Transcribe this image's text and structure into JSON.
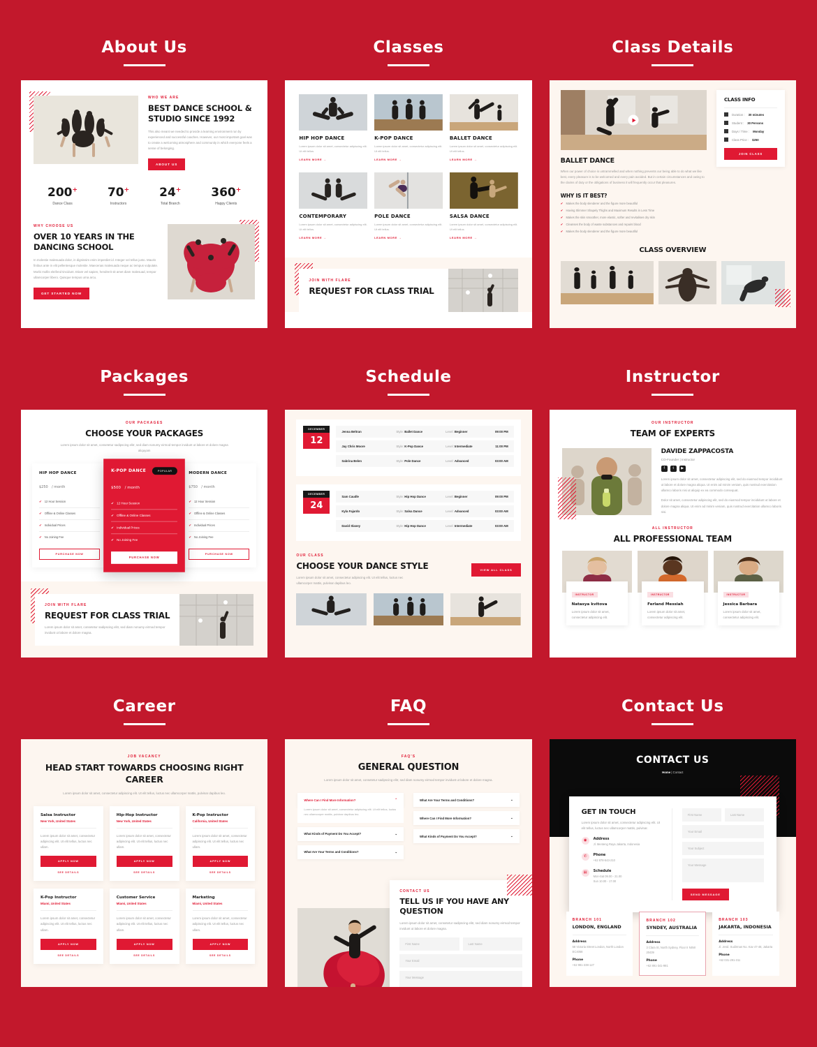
{
  "sections": [
    {
      "title": "About Us"
    },
    {
      "title": "Classes"
    },
    {
      "title": "Class Details"
    },
    {
      "title": "Packages"
    },
    {
      "title": "Schedule"
    },
    {
      "title": "Instructor"
    },
    {
      "title": "Career"
    },
    {
      "title": "FAQ"
    },
    {
      "title": "Contact Us"
    }
  ],
  "about": {
    "eyebrow": "WHO WE ARE",
    "heading": "BEST DANCE SCHOOL & STUDIO SINCE 1992",
    "body": "This also meant we needed to provide a learning environment run by experienced and successful coaches. However, our most important goal was to create a welcoming atmosphere and community in which everyone feels a sense of belonging.",
    "cta": "ABOUT US",
    "stats": [
      {
        "num": "200",
        "sup": "+",
        "label": "Dance Class"
      },
      {
        "num": "70",
        "sup": "+",
        "label": "Instructors"
      },
      {
        "num": "24",
        "sup": "+",
        "label": "Total Branch"
      },
      {
        "num": "360",
        "sup": "+",
        "label": "Happy Clients"
      }
    ],
    "why_eyebrow": "WHY CHOOSE US",
    "why_heading": "OVER 10 YEARS IN THE DANCING SCHOOL",
    "why_body": "In molestie malesuada dolor, in dignissim enim imperdiet id. Integer vel tellus justo. Mauris finibus ante in elit pellentesque molestie. Maecenas malesuada neque ac tempus vulputate. Morbi mollis eleifend tincidunt. Etiam vel sapien, hendrerit sit amet diam malesuad, tempor ullamcorper libero. Quisque tempus urna arcu.",
    "why_cta": "GET STARTED NOW"
  },
  "classes": {
    "items": [
      {
        "title": "HIP HOP DANCE",
        "desc": "Lorem ipsum dolor sit amet, consectetur adipiscing elit. Ut elit tellus.",
        "link": "LEARN MORE →"
      },
      {
        "title": "K-POP DANCE",
        "desc": "Lorem ipsum dolor sit amet, consectetur adipiscing elit. Ut elit tellus.",
        "link": "LEARN MORE →"
      },
      {
        "title": "BALLET DANCE",
        "desc": "Lorem ipsum dolor sit amet, consectetur adipiscing elit. Ut elit tellus.",
        "link": "LEARN MORE →"
      },
      {
        "title": "CONTEMPORARY",
        "desc": "Lorem ipsum dolor sit amet, consectetur adipiscing elit. Ut elit tellus.",
        "link": "LEARN MORE →"
      },
      {
        "title": "POLE DANCE",
        "desc": "Lorem ipsum dolor sit amet, consectetur adipiscing elit. Ut elit tellus.",
        "link": "LEARN MORE →"
      },
      {
        "title": "SALSA DANCE",
        "desc": "Lorem ipsum dolor sit amet, consectetur adipiscing elit. Ut elit tellus.",
        "link": "LEARN MORE →"
      }
    ],
    "trial_eyebrow": "JOIN WITH FLARE",
    "trial_heading": "REQUEST FOR CLASS TRIAL"
  },
  "class_details": {
    "info_title": "CLASS INFO",
    "rows": [
      {
        "label": "Duration :",
        "value": "30 minutes"
      },
      {
        "label": "Student :",
        "value": "30 Persons"
      },
      {
        "label": "Days / Time :",
        "value": "Monday"
      },
      {
        "label": "Class Price :",
        "value": "$250"
      }
    ],
    "join_btn": "JOIN CLASS",
    "title": "BALLET DANCE",
    "body": "When our power of choice is untrammelled and when nothing prevents our being able to do what we like best, every pleasure is to be welcomed and every pain avoided. But in certain circumstances and owing to the claims of duty or the obligations of business it will frequently occur that pleasures.",
    "why_title": "WHY IS IT BEST?",
    "why_items": [
      "Makes the body slenderer and the figure more beautiful",
      "Having Slimmer Shapely Thighs and Maximum Results in Less Time",
      "Makes the skin smoother, more elastic, softer and revitalises dry skin",
      "Cleanses the body of waste substances and repairs blood",
      "Makes the body slenderer and the figure more beautiful"
    ],
    "overview_title": "CLASS OVERVIEW"
  },
  "packages": {
    "eyebrow": "OUR PACKAGES",
    "heading": "CHOOSE YOUR PACKAGES",
    "sub": "Lorem ipsum dolor sit amet, consetetur sadipscing elitr, sed diam nonumy eirmod tempor invidunt ut labore et dolore magna aliquyam",
    "popular_badge": "POPULAR",
    "cards": [
      {
        "name": "HIP HOP DANCE",
        "price": "$250",
        "period": "/ month",
        "features": [
          "12 Hour Session",
          "Offline & Online Classes",
          "Individual Prices",
          "No Joining Fee"
        ],
        "btn": "PURCHASE NOW"
      },
      {
        "name": "K-POP DANCE",
        "price": "$500",
        "period": "/ month",
        "features": [
          "12 Hour Session",
          "Offline & Online Classes",
          "Individual Prices",
          "No Joining Fee"
        ],
        "btn": "PURCHASE NOW"
      },
      {
        "name": "MODERN DANCE",
        "price": "$750",
        "period": "/ month",
        "features": [
          "12 Hour Session",
          "Offline & Online Classes",
          "Individual Prices",
          "No Joining Fee"
        ],
        "btn": "PURCHASE NOW"
      }
    ],
    "trial_eyebrow": "JOIN WITH FLARE",
    "trial_heading": "REQUEST FOR CLASS TRIAL",
    "trial_body": "Lorem ipsum dolor sit amet, consetetur sadipscing elitr, sed diam nonumy eirmod tempor invidunt ut labore et dolore magna."
  },
  "schedule": {
    "blocks": [
      {
        "month": "DECEMBER",
        "day": "12",
        "rows": [
          {
            "name": "Jenna Beltran",
            "style_label": "Style:",
            "style": "Ballet Dance",
            "level_label": "Level:",
            "level": "Beginner",
            "time": "09:00 PM"
          },
          {
            "name": "Jay Chris Moore",
            "style_label": "Style:",
            "style": "K-Pop Dance",
            "level_label": "Level:",
            "level": "Intermediate",
            "time": "11:00 PM"
          },
          {
            "name": "Sabrina Belen",
            "style_label": "Style:",
            "style": "Pole Dance",
            "level_label": "Level:",
            "level": "Advanced",
            "time": "03:00 AM"
          }
        ]
      },
      {
        "month": "DECEMBER",
        "day": "24",
        "rows": [
          {
            "name": "Sam Caudle",
            "style_label": "Style:",
            "style": "Hip Hop Dance",
            "level_label": "Level:",
            "level": "Beginner",
            "time": "09:00 PM"
          },
          {
            "name": "Kyla Fajardo",
            "style_label": "Style:",
            "style": "Salsa Dance",
            "level_label": "Level:",
            "level": "Advanced",
            "time": "03:00 AM"
          },
          {
            "name": "David Slaney",
            "style_label": "Style:",
            "style": "Hip Hop Dance",
            "level_label": "Level:",
            "level": "Intermediate",
            "time": "03:00 AM"
          }
        ]
      }
    ],
    "style_eyebrow": "OUR CLASS",
    "style_heading": "CHOOSE YOUR DANCE STYLE",
    "style_body": "Lorem ipsum dolor sit amet, consectetur adipiscing elit. Ut elit tellus, luctus nec ullamcorper mattis, pulvinar dapibus leo.",
    "view_all": "VIEW ALL CLASS"
  },
  "instructor": {
    "eyebrow": "OUR INSTRUCTOR",
    "heading": "TEAM OF EXPERTS",
    "name": "DAVIDE ZAPPACOSTA",
    "role": "CO-Founder  |  Instructor",
    "bio1": "Lorem ipsum dolor sit amet, consectetur adipiscing elit, sed do eiusmod tempor incididunt ut labore et dolore magna aliqua. Ut enim ad minim veniam, quis nostrud exercitation ullamco laboris nisi ut aliquip ex ea commodo consequat.",
    "bio2": "Dolor sit amet, consectetur adipiscing elit, sed do eiusmod tempor incididunt ut labore et dolore magna aliqua. Ut enim ad minim veniam, quis nostrud exercitation ullamco laboris nisi.",
    "team_eyebrow": "ALL INSTRUCTOR",
    "team_heading": "ALL PROFESSIONAL TEAM",
    "team": [
      {
        "tag": "INSTRUCTOR",
        "name": "Natasya kvitova",
        "desc": "Lorem ipsum dolor sit amet, consectetur adipiscing elit."
      },
      {
        "tag": "INSTRUCTOR",
        "name": "Ferland Messiah",
        "desc": "Lorem ipsum dolor sit amet, consectetur adipiscing elit."
      },
      {
        "tag": "INSTRUCTOR",
        "name": "Jessica Barbara",
        "desc": "Lorem ipsum dolor sit amet, consectetur adipiscing elit."
      }
    ]
  },
  "career": {
    "eyebrow": "JOB VACANCY",
    "heading": "HEAD START TOWARDS CHOOSING RIGHT CAREER",
    "sub": "Lorem ipsum dolor sit amet, consectetur adipiscing elit. Ut elit tellus, luctus nec ullamcorper mattis, pulvinar dapibus leo.",
    "jobs": [
      {
        "title": "Salsa Instructor",
        "loc": "New York, United States",
        "desc": "Lorem ipsum dolor sit amet, consectetur adipiscing elit. Ut elit tellus, luctus nec ullam.",
        "apply": "APPLY NOW",
        "details": "SEE DETAILS"
      },
      {
        "title": "Hip-Hop Instructor",
        "loc": "New York, United States",
        "desc": "Lorem ipsum dolor sit amet, consectetur adipiscing elit. Ut elit tellus, luctus nec ullam.",
        "apply": "APPLY NOW",
        "details": "SEE DETAILS"
      },
      {
        "title": "K-Pop Instructor",
        "loc": "California, United States",
        "desc": "Lorem ipsum dolor sit amet, consectetur adipiscing elit. Ut elit tellus, luctus nec ullam.",
        "apply": "APPLY NOW",
        "details": "SEE DETAILS"
      },
      {
        "title": "K-Pop Instructor",
        "loc": "Miami, United States",
        "desc": "Lorem ipsum dolor sit amet, consectetur adipiscing elit. Ut elit tellus, luctus nec ullam.",
        "apply": "APPLY NOW",
        "details": "SEE DETAILS"
      },
      {
        "title": "Customer Service",
        "loc": "Miami, United States",
        "desc": "Lorem ipsum dolor sit amet, consectetur adipiscing elit. Ut elit tellus, luctus nec ullam.",
        "apply": "APPLY NOW",
        "details": "SEE DETAILS"
      },
      {
        "title": "Marketing",
        "loc": "Miami, United States",
        "desc": "Lorem ipsum dolor sit amet, consectetur adipiscing elit. Ut elit tellus, luctus nec ullam.",
        "apply": "APPLY NOW",
        "details": "SEE DETAILS"
      }
    ]
  },
  "faq": {
    "eyebrow": "FAQ'S",
    "heading": "GENERAL QUESTION",
    "sub": "Lorem ipsum dolor sit amet, consetetur sadipscing elitr, sed diam nonumy eirmod tempor invidunt ut labore et dolore magna.",
    "left": [
      {
        "q": "Where Can I Find More Information?",
        "open": true,
        "a": "Lorem ipsum dolor sit amet, consectetur adipiscing elit. Ut elit tellus, luctus nec ullamcorper mattis, pulvinar dapibus leo."
      },
      {
        "q": "What Kinds of Payment Do You Accept?",
        "open": false
      },
      {
        "q": "What Are Your Terms and Conditions?",
        "open": false
      }
    ],
    "right": [
      {
        "q": "What Are Your Terms and Conditions?",
        "open": false
      },
      {
        "q": "Where Can I Find More Information?",
        "open": false
      },
      {
        "q": "What Kinds of Payment Do You Accept?",
        "open": false
      }
    ],
    "contact_eyebrow": "CONTACT US",
    "contact_heading": "TELL US IF YOU HAVE ANY QUESTION",
    "contact_body": "Lorem ipsum dolor sit amet, consetetur sadipscing elitr, sed diam nonumy eirmod tempor invidunt ut labore et dolore magna.",
    "fields": {
      "first": "First Name",
      "last": "Last Name",
      "email": "Your Email",
      "message": "Your Message"
    }
  },
  "contact": {
    "hero_title": "CONTACT US",
    "crumb_home": "Home",
    "crumb_sep": "|",
    "crumb_current": "Contact",
    "get_in_touch": "GET IN TOUCH",
    "intro": "Lorem ipsum dolor sit amet, consectetur adipiscing elit. Ut elit tellus, luctus nec ullamcorper mattis, pulvinar.",
    "info": [
      {
        "icon": "location-icon",
        "label": "Address",
        "value": "Jl. Menteng Raya Jakarta, Indonesia"
      },
      {
        "icon": "phone-icon",
        "label": "Phone",
        "value": "+62 878-543-210"
      },
      {
        "icon": "calendar-icon",
        "label": "Schedule",
        "value": "Mon-Sat 09.00 - 21.00\nSun 10.00 - 17.00"
      }
    ],
    "fields": {
      "first": "First Name",
      "last": "Last Name",
      "email": "Your Email",
      "subject": "Your Subject",
      "message": "Your Message"
    },
    "send_btn": "SEND MESSAGE",
    "branches": [
      {
        "tag": "BRANCH 101",
        "city": "LONDON, ENGLAND",
        "addr_label": "Address",
        "addr": "58 Victoria Street London, North London EC4058",
        "phone_label": "Phone",
        "phone": "+62 981-338-127"
      },
      {
        "tag": "BRANCH 102",
        "city": "SYNDEY, AUSTRALIA",
        "addr_label": "Address",
        "addr": "3 Clara St, North Sydney, Floor II NSW 20439",
        "phone_label": "Phone",
        "phone": "+62 891-341-981"
      },
      {
        "tag": "BRANCH 103",
        "city": "JAKARTA, INDONESIA",
        "addr_label": "Address",
        "addr": "Jl. Jend. Sudirman No. Kav 47-48, Jakarta",
        "phone_label": "Phone",
        "phone": "+62 031-291-311"
      }
    ]
  }
}
